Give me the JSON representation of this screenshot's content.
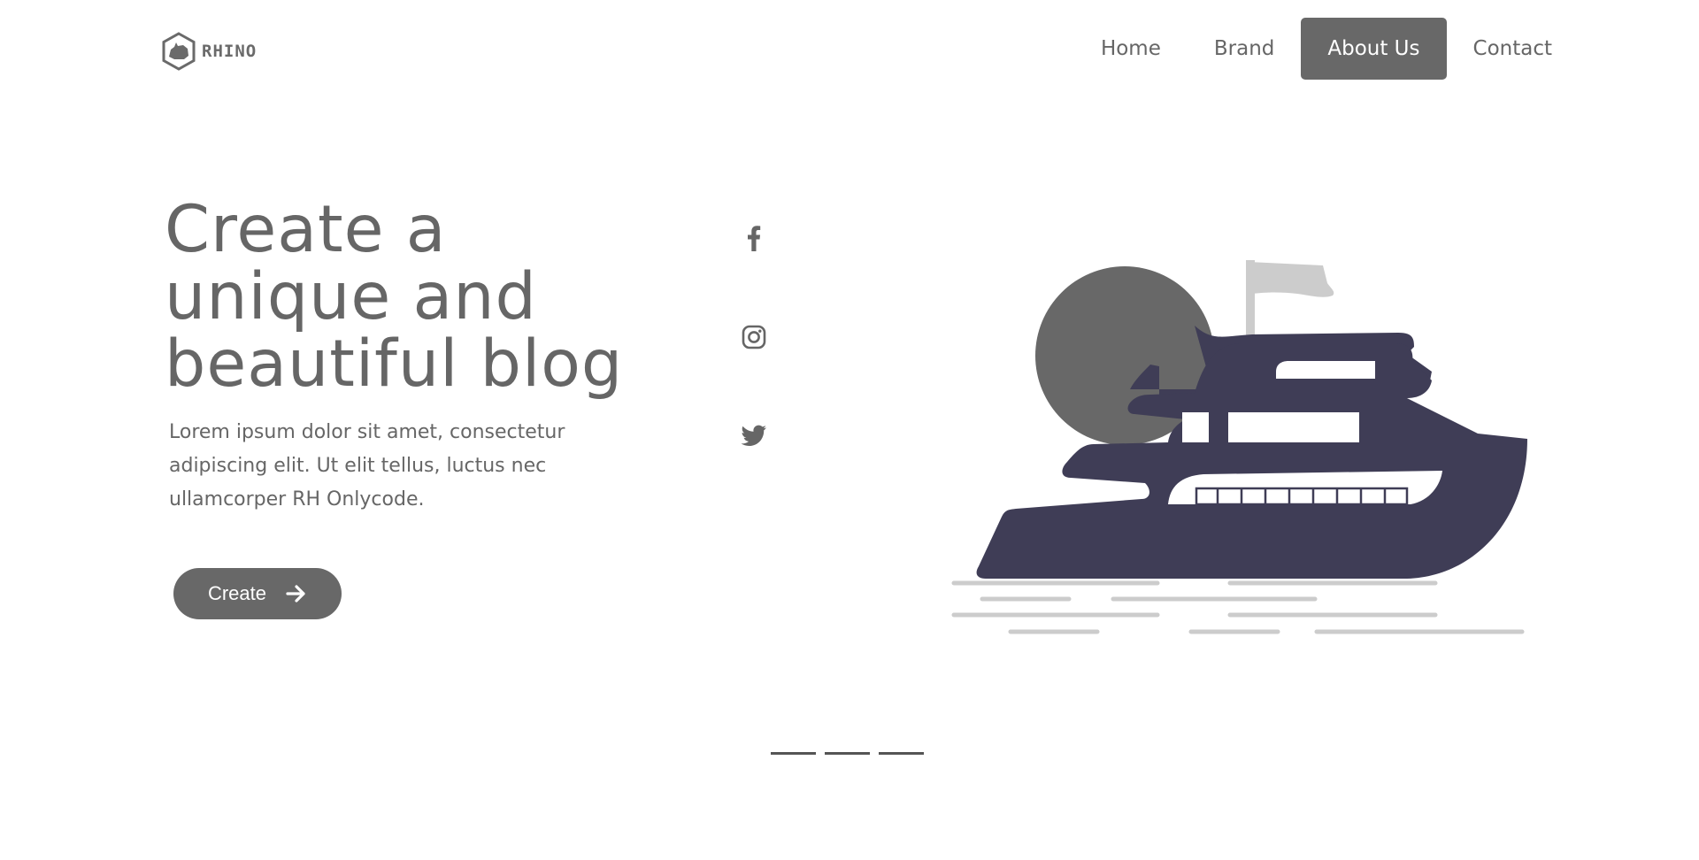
{
  "brand": {
    "name": "RHINO",
    "logo_icon": "rhino-hexagon-icon"
  },
  "nav": {
    "items": [
      {
        "label": "Home",
        "active": false
      },
      {
        "label": "Brand",
        "active": false
      },
      {
        "label": "About Us",
        "active": true
      },
      {
        "label": "Contact",
        "active": false
      }
    ]
  },
  "hero": {
    "title_line1": "Create a",
    "title_line2": "unique and",
    "title_line3": "beautiful blog",
    "description": "Lorem ipsum dolor sit amet, consectetur adipiscing elit. Ut elit tellus, luctus nec ullamcorper RH Onlycode.",
    "cta_label": "Create",
    "cta_icon": "arrow-right-icon"
  },
  "social": [
    {
      "icon": "facebook-icon"
    },
    {
      "icon": "instagram-icon"
    },
    {
      "icon": "twitter-icon"
    }
  ],
  "illustration": {
    "subject": "yacht-illustration",
    "colors": {
      "hull": "#3f3d56",
      "sun": "#686868",
      "flag": "#cccccc",
      "water": "#cccccc"
    }
  },
  "pagination": {
    "count": 3
  },
  "colors": {
    "text": "#666666",
    "accent": "#686868",
    "background": "#ffffff"
  }
}
